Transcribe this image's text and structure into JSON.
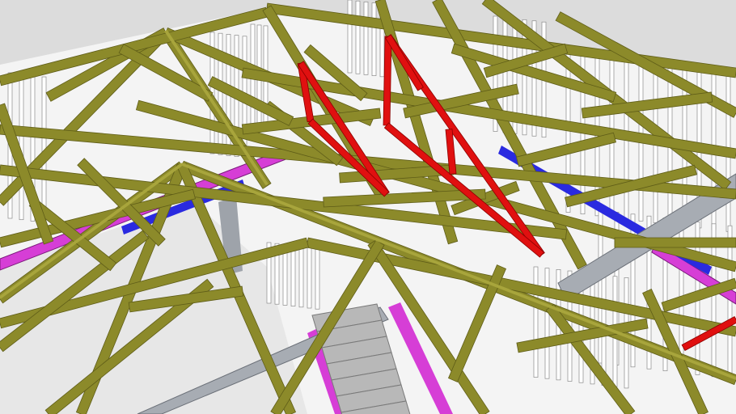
{
  "scene": {
    "description_visible_text": [],
    "colors": {
      "background": "#dcdcdc",
      "floor": "#f2f2f2",
      "timber": "#8c8a2a",
      "timber_dark": "#5f5d18",
      "timber_light": "#a8a53c",
      "wall_stud": "#ffffff",
      "wall_stud_edge": "#8a8a8a",
      "highlight_truss": "#e01010",
      "highlight_truss_dark": "#8a0000",
      "magenta_plate": "#d63ed6",
      "blue_plate": "#2a2ae0",
      "steel": "#a7acb3",
      "stair": "#b8b8b8"
    },
    "icons": [
      "roof-truss-model",
      "red-highlighted-truss",
      "staircase"
    ]
  }
}
